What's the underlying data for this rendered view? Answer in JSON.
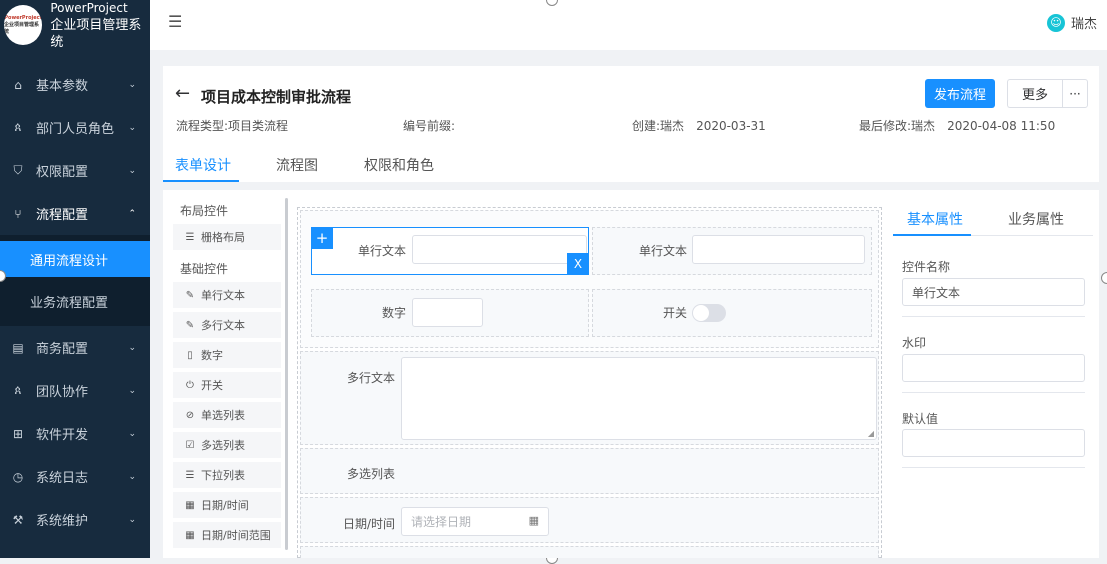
{
  "app": {
    "logo_line1": "PowerProject",
    "logo_line2": "企业项目管理系统",
    "logo_badge_1": "PowerProject",
    "logo_badge_2": "企业项目管理系统"
  },
  "sidebar": {
    "items": [
      {
        "label": "基本参数",
        "icon": "home-icon"
      },
      {
        "label": "部门人员角色",
        "icon": "users-icon"
      },
      {
        "label": "权限配置",
        "icon": "shield-icon"
      },
      {
        "label": "流程配置",
        "icon": "flow-icon",
        "expanded": true
      },
      {
        "label": "商务配置",
        "icon": "document-icon"
      },
      {
        "label": "团队协作",
        "icon": "team-icon"
      },
      {
        "label": "软件开发",
        "icon": "grid-icon"
      },
      {
        "label": "系统日志",
        "icon": "clock-icon"
      },
      {
        "label": "系统维护",
        "icon": "wrench-icon"
      }
    ],
    "sub_items": [
      {
        "label": "通用流程设计",
        "active": true
      },
      {
        "label": "业务流程配置",
        "active": false
      }
    ]
  },
  "topbar": {
    "user_name": "瑞杰"
  },
  "header": {
    "title": "项目成本控制审批流程",
    "publish_label": "发布流程",
    "more_label": "更多",
    "more_dots": "···",
    "meta": {
      "type_label": "流程类型:",
      "type_value": "项目类流程",
      "prefix_label": "编号前缀:",
      "prefix_value": "",
      "created_label": "创建:",
      "created_user": "瑞杰",
      "created_date": "2020-03-31",
      "modified_label": "最后修改:",
      "modified_user": "瑞杰",
      "modified_date": "2020-04-08 11:50"
    },
    "tabs": [
      "表单设计",
      "流程图",
      "权限和角色"
    ],
    "active_tab": 0
  },
  "palette": {
    "layout_group": "布局控件",
    "layout_items": [
      {
        "label": "栅格布局",
        "icon": "grid-lines-icon"
      }
    ],
    "basic_group": "基础控件",
    "basic_items": [
      {
        "label": "单行文本",
        "icon": "pencil-icon"
      },
      {
        "label": "多行文本",
        "icon": "pencil-icon"
      },
      {
        "label": "数字",
        "icon": "clipboard-icon"
      },
      {
        "label": "开关",
        "icon": "power-icon"
      },
      {
        "label": "单选列表",
        "icon": "radio-check-icon"
      },
      {
        "label": "多选列表",
        "icon": "checkbox-icon"
      },
      {
        "label": "下拉列表",
        "icon": "list-icon"
      },
      {
        "label": "日期/时间",
        "icon": "calendar-icon"
      },
      {
        "label": "日期/时间范围",
        "icon": "calendar-icon"
      }
    ]
  },
  "form": {
    "text1_label": "单行文本",
    "text2_label": "单行文本",
    "number_label": "数字",
    "switch_label": "开关",
    "switch_on": false,
    "textarea_label": "多行文本",
    "multiselect_label": "多选列表",
    "date_label": "日期/时间",
    "date_placeholder": "请选择日期",
    "add_symbol": "+",
    "delete_symbol": "X"
  },
  "properties": {
    "tabs": [
      "基本属性",
      "业务属性"
    ],
    "active_tab": 0,
    "name_label": "控件名称",
    "name_value": "单行文本",
    "watermark_label": "水印",
    "watermark_value": "",
    "default_label": "默认值",
    "default_value": ""
  },
  "colors": {
    "sidebar_bg": "#172b3e",
    "accent": "#1890ff",
    "avatar": "#17c4d6"
  }
}
